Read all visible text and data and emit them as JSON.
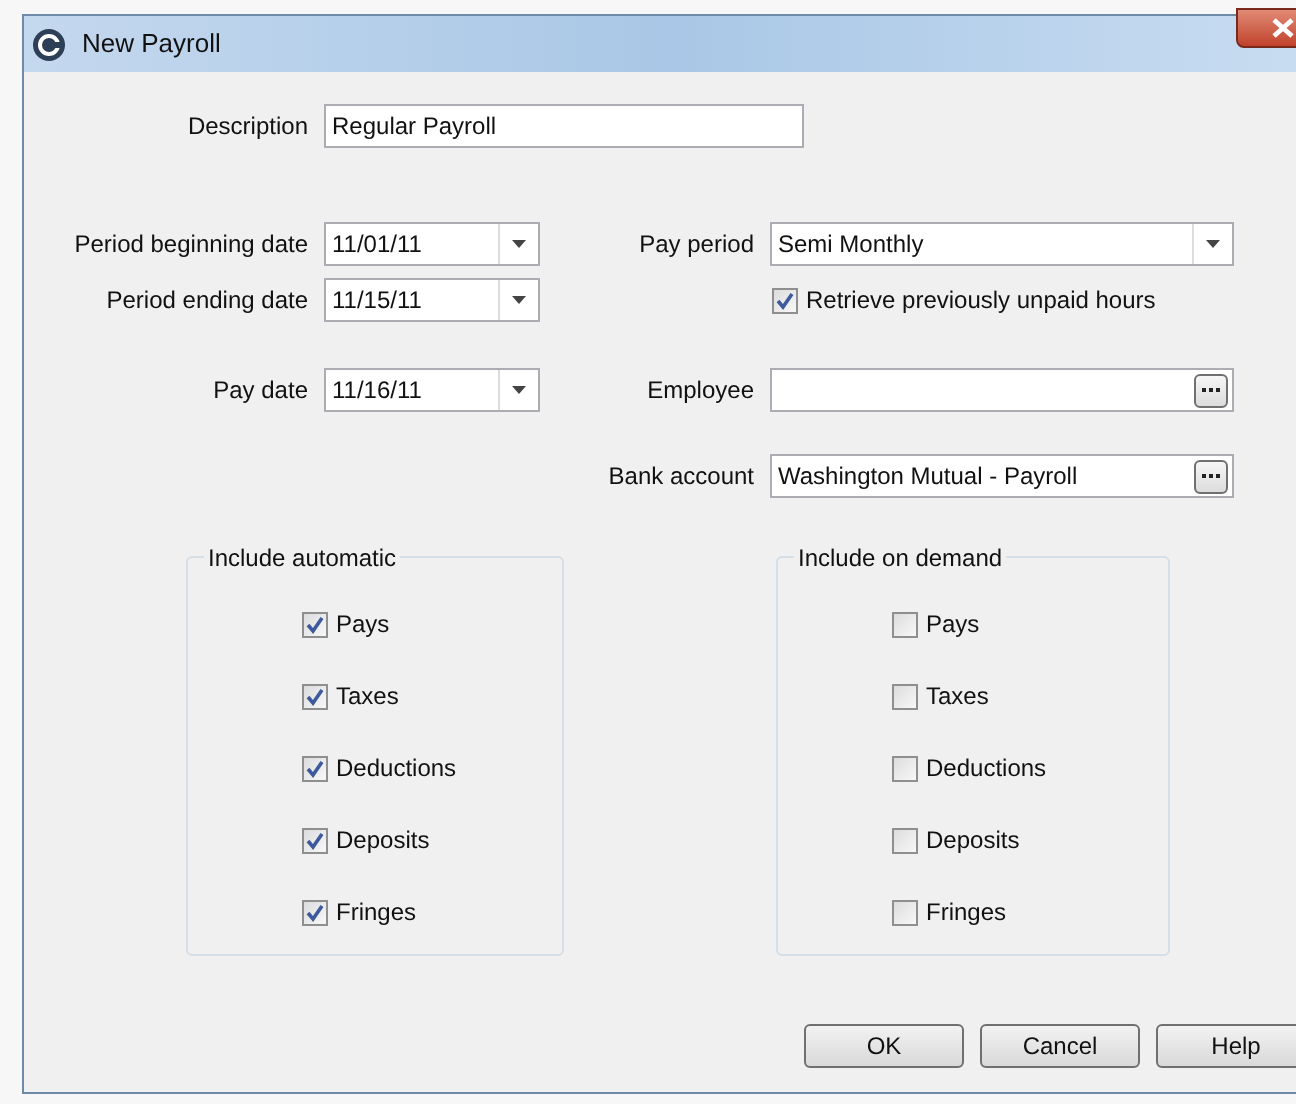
{
  "window": {
    "title": "New Payroll"
  },
  "description": {
    "label": "Description",
    "value": "Regular Payroll"
  },
  "dates": [
    {
      "label": "Period beginning date",
      "value": "11/01/11"
    },
    {
      "label": "Period ending date",
      "value": "11/15/11"
    },
    {
      "label": "Pay date",
      "value": "11/16/11"
    }
  ],
  "pay_period": {
    "label": "Pay period",
    "value": "Semi Monthly"
  },
  "retrieve_unpaid": {
    "label": "Retrieve previously unpaid hours",
    "checked": true
  },
  "employee": {
    "label": "Employee"
  },
  "bank_account": {
    "label": "Bank account",
    "value": "Washington Mutual - Payroll"
  },
  "groups": [
    {
      "title": "Include automatic",
      "items": [
        {
          "label": "Pays",
          "checked": true
        },
        {
          "label": "Taxes",
          "checked": true
        },
        {
          "label": "Deductions",
          "checked": true
        },
        {
          "label": "Deposits",
          "checked": true
        },
        {
          "label": "Fringes",
          "checked": true
        }
      ]
    },
    {
      "title": "Include on demand",
      "items": [
        {
          "label": "Pays",
          "checked": false
        },
        {
          "label": "Taxes",
          "checked": false
        },
        {
          "label": "Deductions",
          "checked": false
        },
        {
          "label": "Deposits",
          "checked": false
        },
        {
          "label": "Fringes",
          "checked": false
        }
      ]
    }
  ],
  "buttons": [
    "OK",
    "Cancel",
    "Help"
  ]
}
